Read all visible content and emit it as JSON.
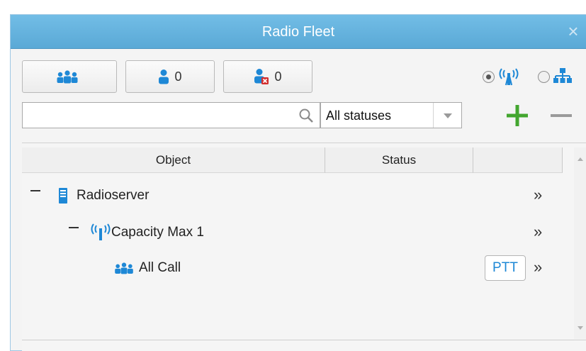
{
  "window": {
    "title": "Radio Fleet",
    "close_glyph": "×"
  },
  "toolbar": {
    "buttons": [
      {
        "icon": "group-icon",
        "label": ""
      },
      {
        "icon": "user-icon",
        "label": "0"
      },
      {
        "icon": "user-error-icon",
        "label": "0"
      }
    ],
    "view_mode": {
      "options": [
        {
          "icon": "radio-system-icon",
          "selected": true
        },
        {
          "icon": "hierarchy-icon",
          "selected": false
        }
      ]
    }
  },
  "filter": {
    "search": {
      "value": "",
      "placeholder": ""
    },
    "status_select": {
      "value": "All statuses"
    },
    "add_glyph": "+",
    "remove_glyph": "−"
  },
  "grid": {
    "columns": [
      "Object",
      "Status",
      ""
    ],
    "rows": [
      {
        "label": "Radioserver",
        "icon": "server-icon",
        "expanded": true,
        "toggle": "−",
        "action": "»"
      },
      {
        "label": "Capacity Max 1",
        "icon": "radio-system-icon",
        "expanded": true,
        "toggle": "−",
        "action": "»"
      },
      {
        "label": "All Call",
        "icon": "group-icon",
        "button": "PTT",
        "action": "»"
      }
    ]
  },
  "colors": {
    "titlebar": "#5aa9d6",
    "accent_blue": "#1e88d6",
    "add_green": "#43a62f",
    "remove_gray": "#9a9a9a"
  }
}
